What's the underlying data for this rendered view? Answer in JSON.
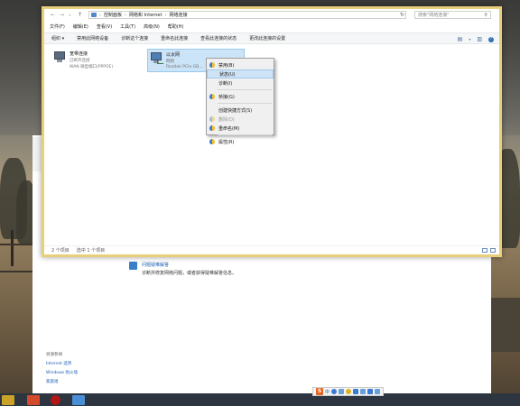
{
  "colors": {
    "window_border": "#e8cf7a",
    "link": "#1c5fb0",
    "selection": "#cce4f7",
    "menu_highlight": "#cfe3f6"
  },
  "window": {
    "nav_back": "←",
    "nav_forward": "→",
    "nav_recent": "∨",
    "nav_up": "↑",
    "breadcrumb": [
      "控制面板",
      "网络和 Internet",
      "网络连接"
    ],
    "breadcrumb_sep": "›",
    "refresh_icon": "refresh-icon",
    "search_placeholder": "搜索\"网络连接\"",
    "search_icon": "⚲"
  },
  "menubar": [
    "文件(F)",
    "编辑(E)",
    "查看(V)",
    "工具(T)",
    "高级(N)",
    "帮助(H)"
  ],
  "toolbar": {
    "organize": "组织 ▾",
    "commands": [
      "禁用此网络设备",
      "诊断这个连接",
      "重命名此连接",
      "查看此连接的状态",
      "更改此连接的设置"
    ],
    "view_icon": "▤",
    "dropdown_icon": "▾",
    "pane_icon": "▥",
    "help_icon": "?"
  },
  "connections": [
    {
      "name": "宽带连接",
      "status": "已断开连接",
      "device": "WAN 微型端口(PPPOE)"
    },
    {
      "name": "以太网",
      "status": "网络",
      "device": "Realtek PCIe GB..."
    }
  ],
  "context_menu": [
    {
      "label": "禁用(B)",
      "shield": true,
      "disabled": false,
      "highlight": false
    },
    {
      "label": "状态(U)",
      "shield": false,
      "disabled": false,
      "highlight": true
    },
    {
      "label": "诊断(I)",
      "shield": false,
      "disabled": false,
      "highlight": false
    },
    {
      "separator": true
    },
    {
      "label": "桥接(G)",
      "shield": true,
      "disabled": false,
      "highlight": false
    },
    {
      "separator": true
    },
    {
      "label": "创建快捷方式(S)",
      "shield": false,
      "disabled": false,
      "highlight": false
    },
    {
      "label": "删除(D)",
      "shield": true,
      "disabled": true,
      "highlight": false
    },
    {
      "label": "重命名(M)",
      "shield": true,
      "disabled": false,
      "highlight": false
    },
    {
      "separator": true
    },
    {
      "label": "属性(R)",
      "shield": true,
      "disabled": false,
      "highlight": false
    }
  ],
  "statusbar": {
    "count": "2 个项目",
    "selected": "选中 1 个项目"
  },
  "background_panel": {
    "troubleshoot_title": "问题疑难解答",
    "troubleshoot_desc": "诊断并修复网络问题，或者获得疑难解答信息。",
    "see_also": "另请参阅",
    "links": [
      "Internet 选项",
      "Windows 防火墙",
      "家庭组"
    ]
  },
  "tray": {
    "ime_logo": "S",
    "ime_lang": "中"
  }
}
